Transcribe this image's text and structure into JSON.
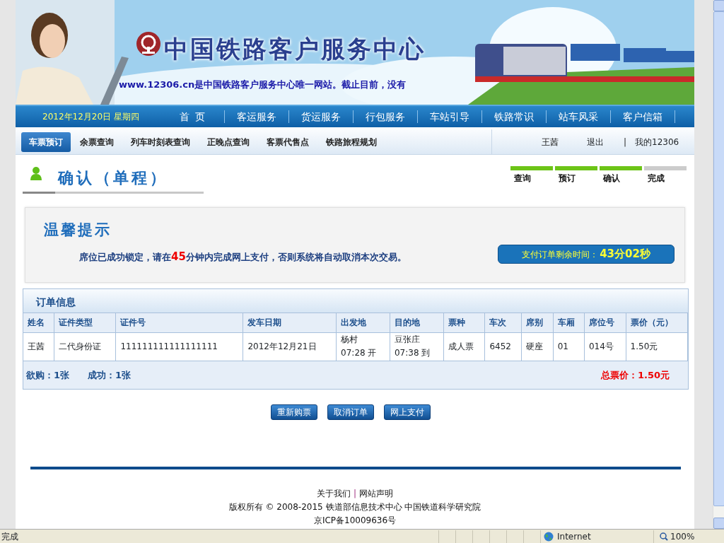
{
  "banner": {
    "title": "中国铁路客户服务中心",
    "marquee": "www.12306.cn是中国铁路客户服务中心唯一网站。截止目前，没有"
  },
  "nav": {
    "date": "2012年12月20日  星期四",
    "items": [
      "首  页",
      "客运服务",
      "货运服务",
      "行包服务",
      "车站引导",
      "铁路常识",
      "站车风采",
      "客户信箱"
    ]
  },
  "subnav": {
    "tabs": [
      {
        "label": "车票预订",
        "selected": true
      },
      {
        "label": "余票查询",
        "selected": false
      },
      {
        "label": "列车时刻表查询",
        "selected": false
      },
      {
        "label": "正晚点查询",
        "selected": false
      },
      {
        "label": "客票代售点",
        "selected": false
      },
      {
        "label": "铁路旅程规划",
        "selected": false
      }
    ],
    "user": "王茜",
    "logout": "退出",
    "separator": "|",
    "my": "我的12306"
  },
  "heading": {
    "title": "确认（单程）",
    "steps": [
      {
        "label": "查询",
        "done": true
      },
      {
        "label": "预订",
        "done": true
      },
      {
        "label": "确认",
        "done": true
      },
      {
        "label": "完成",
        "done": false
      }
    ]
  },
  "notice": {
    "title": "温馨提示",
    "text": "席位已成功锁定，请在**45**分钟内完成网上支付，否则系统将自动取消本次交易。",
    "timer_label": "支付订单剩余时间：",
    "timer_value": "43分02秒"
  },
  "order": {
    "title": "订单信息",
    "columns": [
      "姓名",
      "证件类型",
      "证件号",
      "发车日期",
      "出发地",
      "目的地",
      "票种",
      "车次",
      "席别",
      "车厢",
      "席位号",
      "票价（元）"
    ],
    "rows": [
      [
        "王茜",
        "二代身份证",
        "111111111111111111",
        "2012年12月21日",
        [
          "杨村",
          "07:28  开"
        ],
        [
          "豆张庄",
          "07:38  到"
        ],
        "成人票",
        "6452",
        "硬座",
        "01",
        "014号",
        "1.50元"
      ]
    ],
    "wanted": "欲购：1张",
    "success": "成功：1张",
    "total": "总票价：1.50元"
  },
  "buttons": [
    "重新购票",
    "取消订单",
    "网上支付"
  ],
  "footer": {
    "links": [
      "关于我们",
      "网站声明"
    ],
    "separator": "|",
    "copyright": "版权所有  © 2008-2015 铁道部信息技术中心  中国铁道科学研究院",
    "icp": "京ICP备10009636号"
  },
  "status_bar": {
    "text": "完成",
    "zone": "Internet",
    "zoom": "100%"
  }
}
